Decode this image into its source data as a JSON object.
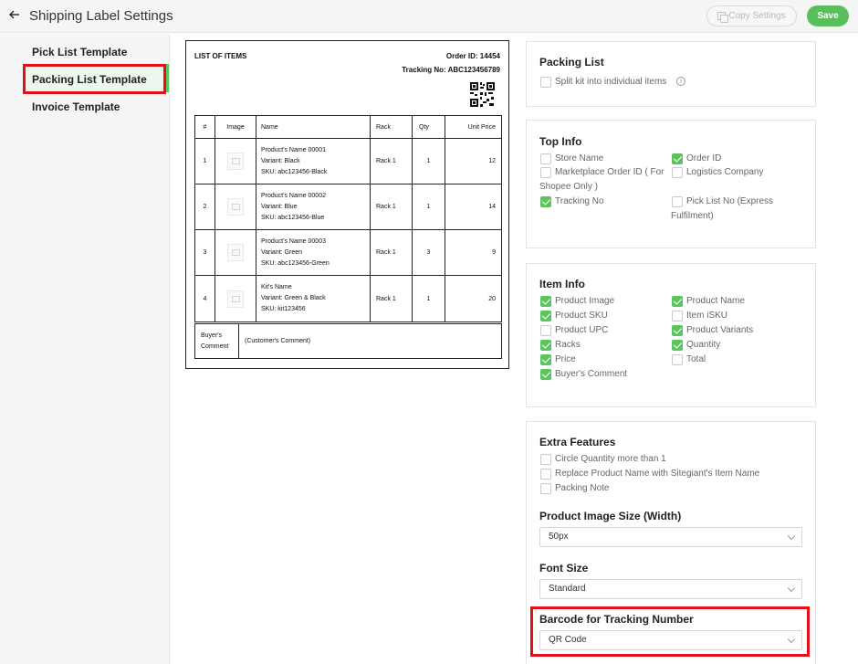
{
  "header": {
    "title": "Shipping Label Settings",
    "copy_label": "Copy Settings",
    "save_label": "Save"
  },
  "sidebar": {
    "items": [
      {
        "label": "Pick List Template"
      },
      {
        "label": "Packing List Template",
        "active": true
      },
      {
        "label": "Invoice Template"
      }
    ]
  },
  "preview": {
    "list_title": "LIST OF ITEMS",
    "order_id": "Order ID: 14454",
    "tracking_no": "Tracking No: ABC123456789",
    "columns": [
      "#",
      "Image",
      "Name",
      "Rack",
      "Qty",
      "Unit Price"
    ],
    "rows": [
      {
        "no": "1",
        "name": "Product's Name 00001",
        "variant": "Variant: Black",
        "sku": "SKU: abc123456-Black",
        "rack": "Rack 1",
        "qty": "1",
        "price": "12"
      },
      {
        "no": "2",
        "name": "Product's Name 00002",
        "variant": "Variant: Blue",
        "sku": "SKU: abc123456-Blue",
        "rack": "Rack 1",
        "qty": "1",
        "price": "14"
      },
      {
        "no": "3",
        "name": "Product's Name 00003",
        "variant": "Variant: Green",
        "sku": "SKU: abc123456-Green",
        "rack": "Rack 1",
        "qty": "3",
        "price": "9"
      },
      {
        "no": "4",
        "name": "Kit's Name",
        "variant": "Variant: Green & Black",
        "sku": "SKU: kit123456",
        "rack": "Rack 1",
        "qty": "1",
        "price": "20"
      }
    ],
    "comment_label_1": "Buyer's",
    "comment_label_2": "Comment",
    "comment_value": "(Customer's Comment)"
  },
  "packing_list": {
    "title": "Packing List",
    "split_kit": {
      "label": "Split kit into individual items",
      "checked": false
    }
  },
  "top_info": {
    "title": "Top Info",
    "store_name": {
      "label": "Store Name",
      "checked": false
    },
    "order_id": {
      "label": "Order ID",
      "checked": true
    },
    "marketplace_order_id_1": "Marketplace Order ID ( For",
    "marketplace_order_id_2": "Shopee Only )",
    "marketplace_checked": false,
    "logistics_company": {
      "label": "Logistics Company",
      "checked": false
    },
    "tracking_no": {
      "label": "Tracking No",
      "checked": true
    },
    "pick_list_no_1": "Pick List No (Express",
    "pick_list_no_2": "Fulfilment)",
    "pick_list_checked": false
  },
  "item_info": {
    "title": "Item Info",
    "left": [
      {
        "label": "Product Image",
        "checked": true
      },
      {
        "label": "Product SKU",
        "checked": true
      },
      {
        "label": "Product UPC",
        "checked": false
      },
      {
        "label": "Racks",
        "checked": true
      },
      {
        "label": "Price",
        "checked": true
      },
      {
        "label": "Buyer's Comment",
        "checked": true
      }
    ],
    "right": [
      {
        "label": "Product Name",
        "checked": true
      },
      {
        "label": "Item iSKU",
        "checked": false
      },
      {
        "label": "Product Variants",
        "checked": true
      },
      {
        "label": "Quantity",
        "checked": true
      },
      {
        "label": "Total",
        "checked": false
      }
    ]
  },
  "extra_features": {
    "title": "Extra Features",
    "options": [
      {
        "label": "Circle Quantity more than 1",
        "checked": false
      },
      {
        "label": "Replace Product Name with Sitegiant's Item Name",
        "checked": false
      },
      {
        "label": "Packing Note",
        "checked": false
      }
    ],
    "image_size_label": "Product Image Size (Width)",
    "image_size_value": "50px",
    "font_size_label": "Font Size",
    "font_size_value": "Standard",
    "barcode_label": "Barcode for Tracking Number",
    "barcode_value": "QR Code"
  },
  "colors": {
    "accent_green": "#5cc35e",
    "highlight_red": "#e30e19"
  }
}
